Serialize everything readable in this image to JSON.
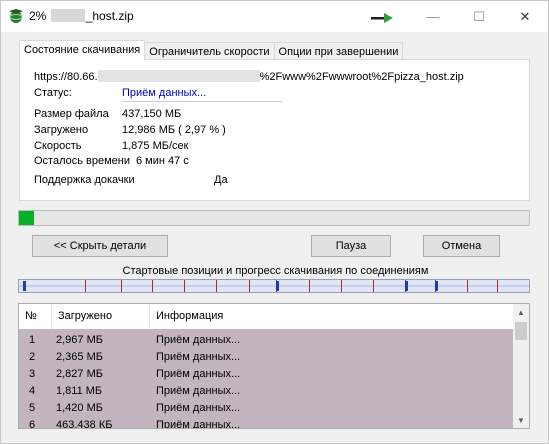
{
  "window": {
    "title_prefix": "2%",
    "title_suffix": "_host.zip",
    "icons": {
      "app": "download-globe-icon",
      "arrow": "green-arrow-icon",
      "minimize": "minimize-icon",
      "maximize": "maximize-icon",
      "close": "close-icon"
    },
    "controls": {
      "minimize": "—",
      "maximize": "☐",
      "close": "✕"
    }
  },
  "tabs": [
    {
      "label": "Состояние скачивания",
      "active": true
    },
    {
      "label": "Ограничитель скорости",
      "active": false
    },
    {
      "label": "Опции при завершении",
      "active": false
    }
  ],
  "status_panel": {
    "url_prefix": "https://80.66.",
    "url_suffix": "%2Fwww%2Fwwwroot%2Fpizza_host.zip",
    "status_label": "Статус:",
    "status_value": "Приём данных...",
    "file_size_label": "Размер файла",
    "file_size_value": "437,150  МБ",
    "downloaded_label": "Загружено",
    "downloaded_value": "12,986  МБ  ( 2,97 % )",
    "speed_label": "Скорость",
    "speed_value": "1,875  МБ/сек",
    "time_left_label": "Осталось времени",
    "time_left_value": "6 мин 47 с",
    "resume_label": "Поддержка докачки",
    "resume_value": "Да"
  },
  "progress": {
    "percent": 2.97,
    "color": "#06b025"
  },
  "buttons": {
    "hide_details": "<< Скрыть детали",
    "pause": "Пауза",
    "cancel": "Отмена"
  },
  "connections": {
    "caption": "Стартовые позиции и прогресс скачивания по соединениям"
  },
  "list": {
    "columns": [
      "№",
      "Загружено",
      "Информация"
    ],
    "rows": [
      {
        "n": "1",
        "downloaded": "2,967  МБ",
        "info": "Приём данных..."
      },
      {
        "n": "2",
        "downloaded": "2,365  МБ",
        "info": "Приём данных..."
      },
      {
        "n": "3",
        "downloaded": "2,827  МБ",
        "info": "Приём данных..."
      },
      {
        "n": "4",
        "downloaded": "1,811  МБ",
        "info": "Приём данных..."
      },
      {
        "n": "5",
        "downloaded": "1,420  МБ",
        "info": "Приём данных..."
      },
      {
        "n": "6",
        "downloaded": "463,438  КБ",
        "info": "Приём данных..."
      }
    ],
    "row_color": "#c2b5bf"
  }
}
